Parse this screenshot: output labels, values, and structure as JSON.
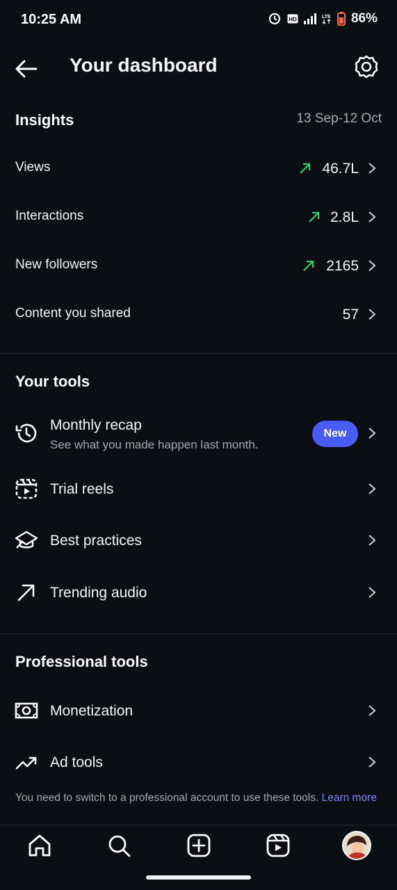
{
  "status_bar": {
    "time": "10:25 AM",
    "battery": "86%",
    "icons": [
      "alarm-icon",
      "hd-icon",
      "signal-icon",
      "lte-icon",
      "battery-icon"
    ]
  },
  "header": {
    "title": "Your dashboard",
    "back_icon": "back-arrow-icon",
    "settings_icon": "gear-icon"
  },
  "insights": {
    "title": "Insights",
    "date_range": "13 Sep-12 Oct",
    "rows": [
      {
        "label": "Views",
        "value": "46.7L",
        "trend": "up"
      },
      {
        "label": "Interactions",
        "value": "2.8L",
        "trend": "up"
      },
      {
        "label": "New followers",
        "value": "2165",
        "trend": "up"
      },
      {
        "label": "Content you shared",
        "value": "57",
        "trend": "none"
      }
    ]
  },
  "your_tools": {
    "title": "Your tools",
    "items": [
      {
        "label": "Monthly recap",
        "subtitle": "See what you made happen last month.",
        "badge": "New",
        "icon": "history-icon"
      },
      {
        "label": "Trial reels",
        "icon": "trial-reels-icon"
      },
      {
        "label": "Best practices",
        "icon": "graduation-cap-icon"
      },
      {
        "label": "Trending audio",
        "icon": "trending-arrow-icon"
      }
    ]
  },
  "professional_tools": {
    "title": "Professional tools",
    "items": [
      {
        "label": "Monetization",
        "icon": "money-icon"
      },
      {
        "label": "Ad tools",
        "icon": "chart-trend-icon"
      }
    ],
    "note": "You need to switch to a professional account to use these tools.",
    "note_link": "Learn more"
  },
  "bottom_nav": {
    "items": [
      "home-icon",
      "search-icon",
      "create-icon",
      "reels-icon",
      "profile-avatar"
    ]
  },
  "colors": {
    "background": "#0b0f14",
    "accent": "#4a5af5",
    "trend_up": "#2fcf6c",
    "link": "#7c86ff"
  }
}
